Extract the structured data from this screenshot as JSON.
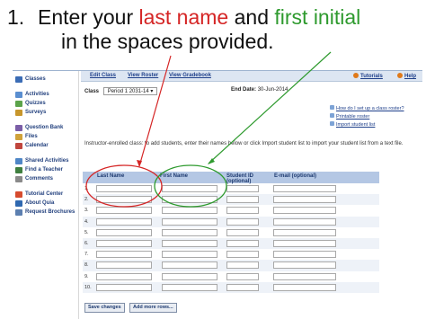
{
  "slide": {
    "number": "1.",
    "line1_before": "Enter your ",
    "red_text": "last name",
    "line1_middle": " and ",
    "green_text": "first initial",
    "line2": "in the spaces provided."
  },
  "sidebar": {
    "items": [
      {
        "label": "Classes",
        "icon": "classes-icon",
        "color": "#3b6cb5"
      },
      {
        "label": "Activities",
        "icon": "activities-icon",
        "color": "#5a8ed0"
      },
      {
        "label": "Quizzes",
        "icon": "quizzes-icon",
        "color": "#5ba34a"
      },
      {
        "label": "Surveys",
        "icon": "surveys-icon",
        "color": "#c7962c"
      },
      {
        "label": "Question Bank",
        "icon": "question-bank-icon",
        "color": "#7b5ea7"
      },
      {
        "label": "Files",
        "icon": "files-icon",
        "color": "#d0a23a"
      },
      {
        "label": "Calendar",
        "icon": "calendar-icon",
        "color": "#c0463d"
      },
      {
        "label": "Shared Activities",
        "icon": "shared-icon",
        "color": "#4f86c6"
      },
      {
        "label": "Find a Teacher",
        "icon": "teacher-icon",
        "color": "#3f7f3f"
      },
      {
        "label": "Comments",
        "icon": "comments-icon",
        "color": "#8a8a8a"
      },
      {
        "label": "Tutorial Center",
        "icon": "tutorial-icon",
        "color": "#d64b2e"
      },
      {
        "label": "About Quia",
        "icon": "about-icon",
        "color": "#2f68b0"
      },
      {
        "label": "Request Brochures",
        "icon": "brochure-icon",
        "color": "#5c7fb0"
      }
    ]
  },
  "topnav": {
    "tabs": [
      "Edit Class",
      "View Roster",
      "View Gradebook"
    ],
    "tutorials": "Tutorials",
    "help": "Help"
  },
  "class": {
    "label": "Class",
    "selected": "Period 1 2031-14",
    "end_date_label": "End Date:",
    "end_date": "30-Jun-2014"
  },
  "links": [
    "How do I set up a class roster?",
    "Printable roster",
    "Import student list"
  ],
  "instructions": "Instructor-enrolled class: to add students, enter their names below or click Import student list to import your student list from a text file.",
  "grid": {
    "headers": [
      "Last Name",
      "First Name",
      "Student ID (optional)",
      "E-mail (optional)"
    ],
    "rows": [
      "1.",
      "2.",
      "3.",
      "4.",
      "5.",
      "6.",
      "7.",
      "8.",
      "9.",
      "10."
    ]
  },
  "buttons": {
    "save": "Save changes",
    "add_more": "Add more rows..."
  },
  "colors": {
    "red_annotation": "#d52525",
    "green_annotation": "#2e9a2e",
    "header_bg": "#b4c7e4",
    "nav_bg": "#dde6f2"
  }
}
